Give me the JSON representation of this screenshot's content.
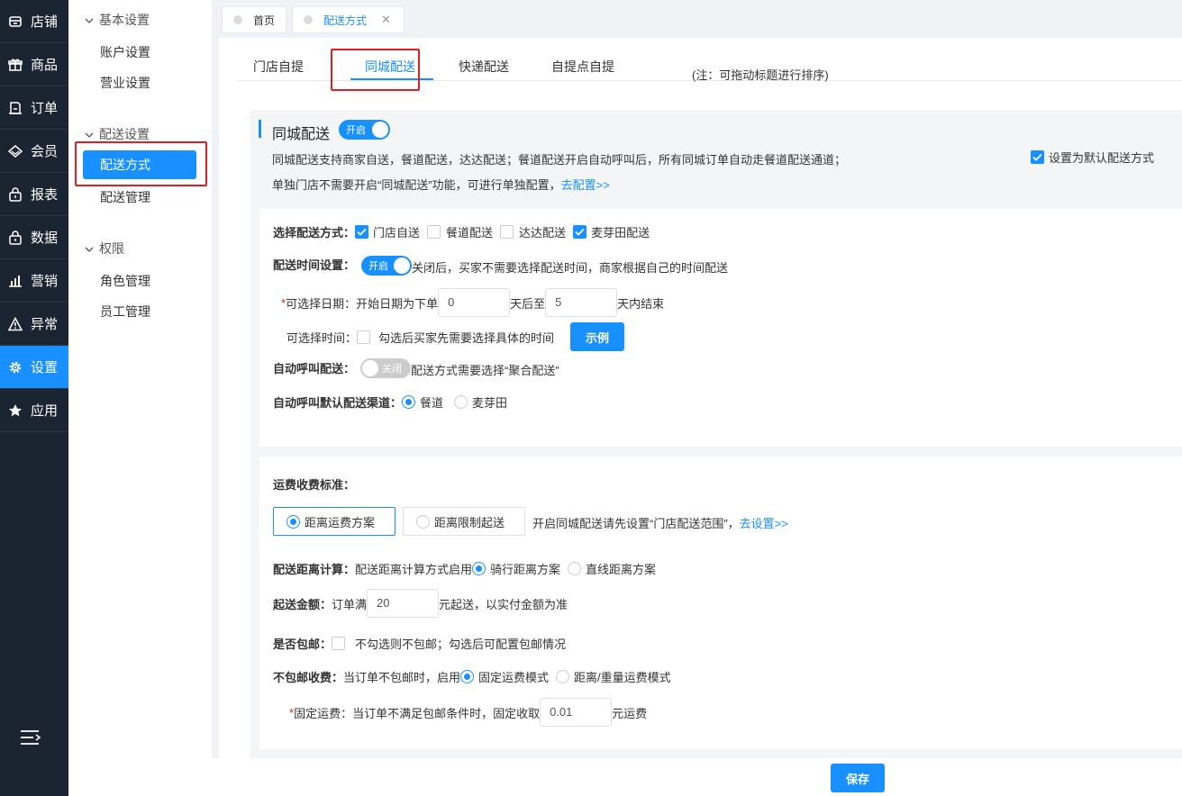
{
  "nav": {
    "items": [
      {
        "label": "店铺",
        "icon": "store-icon"
      },
      {
        "label": "商品",
        "icon": "gift-icon"
      },
      {
        "label": "订单",
        "icon": "order-icon"
      },
      {
        "label": "会员",
        "icon": "diamond-icon"
      },
      {
        "label": "报表",
        "icon": "lock-bag-icon"
      },
      {
        "label": "数据",
        "icon": "bag-icon"
      },
      {
        "label": "营销",
        "icon": "bar-chart-icon"
      },
      {
        "label": "异常",
        "icon": "warning-icon"
      },
      {
        "label": "设置",
        "icon": "gear-icon"
      },
      {
        "label": "应用",
        "icon": "star-icon"
      }
    ],
    "active": "设置"
  },
  "sidebar": {
    "group1": "基本设置",
    "item1": "账户设置",
    "item2": "营业设置",
    "group2": "配送设置",
    "item3": "配送方式",
    "item4": "配送管理",
    "group3": "权限",
    "item5": "角色管理",
    "item6": "员工管理"
  },
  "page_tabs": {
    "home": "首页",
    "current": "配送方式"
  },
  "delivery_tabs": {
    "t1": "门店自提",
    "t2": "同城配送",
    "t3": "快递配送",
    "t4": "自提点自提",
    "note": "(注：可拖动标题进行排序)"
  },
  "panel": {
    "title": "同城配送",
    "toggle_on": "开启",
    "desc1": "同城配送支持商家自送，餐道配送，达达配送；餐道配送开启自动呼叫后，所有同城订单自动走餐道配送通道；",
    "desc2": "单独门店不需要开启“同城配送”功能，可进行单独配置，",
    "desc2_link": "去配置>>",
    "default_label": "设置为默认配送方式"
  },
  "method": {
    "label": "选择配送方式：",
    "opts": [
      {
        "label": "门店自送",
        "checked": true
      },
      {
        "label": "餐道配送",
        "checked": false
      },
      {
        "label": "达达配送",
        "checked": false
      },
      {
        "label": "麦芽田配送",
        "checked": true
      }
    ]
  },
  "time": {
    "label": "配送时间设置：",
    "toggle": "开启",
    "desc": "关闭后，买家不需要选择配送时间，商家根据自己的时间配送",
    "date_req": "*",
    "date_label": "可选择日期：开始日期为下单",
    "date_start": "0",
    "date_mid": "天后至",
    "date_end": "5",
    "date_suffix": "天内结束",
    "time_label": "可选择时间：",
    "time_cb": "勾选后买家先需要选择具体的时间",
    "example_btn": "示例"
  },
  "auto_call": {
    "label": "自动呼叫配送：",
    "toggle": "关闭",
    "desc": "配送方式需要选择“聚合配送”",
    "channel_label": "自动呼叫默认配送渠道：",
    "channels": [
      {
        "label": "餐道",
        "checked": true
      },
      {
        "label": "麦芽田",
        "checked": false
      }
    ]
  },
  "fee": {
    "label": "运费收费标准：",
    "opt1": "距离运费方案",
    "opt2": "距离限制起送",
    "hint": "开启同城配送请先设置“门店配送范围”，",
    "hint_link": "去设置>>",
    "distance_label": "配送距离计算：",
    "distance_desc": "配送距离计算方式启用",
    "distance_opts": [
      {
        "label": "骑行距离方案",
        "checked": true
      },
      {
        "label": "直线距离方案",
        "checked": false
      }
    ],
    "min_label": "起送金额：",
    "min_prefix": "订单满",
    "min_value": "20",
    "min_suffix": "元起送，以实付金额为准",
    "free_label": "是否包邮：",
    "free_desc": "不勾选则不包邮；勾选后可配置包邮情况",
    "nofree_label": "不包邮收费：",
    "nofree_desc": "当订单不包邮时，启用",
    "nofree_opts": [
      {
        "label": "固定运费模式",
        "checked": true
      },
      {
        "label": "距离/重量运费模式",
        "checked": false
      }
    ],
    "fixed_req": "*",
    "fixed_label": "固定运费：当订单不满足包邮条件时，固定收取",
    "fixed_value": "0.01",
    "fixed_suffix": "元运费"
  },
  "footer": {
    "save": "保存"
  }
}
